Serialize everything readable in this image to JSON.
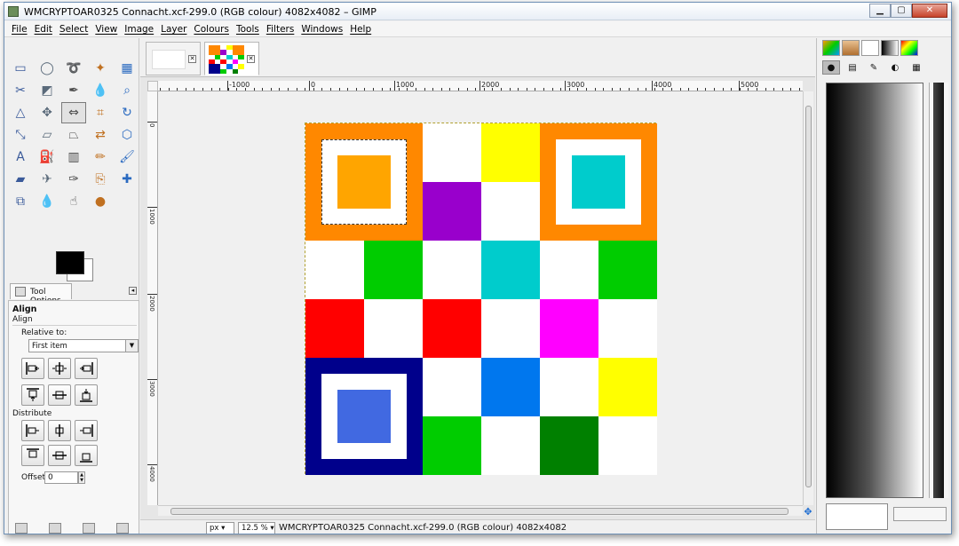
{
  "window": {
    "title": "WMCRYPTOAR0325 Connacht.xcf-299.0 (RGB colour) 4082x4082 – GIMP",
    "minimize_glyph": "▁",
    "maximize_glyph": "▢",
    "close_glyph": "✕"
  },
  "menubar": {
    "items": [
      "File",
      "Edit",
      "Select",
      "View",
      "Image",
      "Layer",
      "Colours",
      "Tools",
      "Filters",
      "Windows",
      "Help"
    ]
  },
  "toolbox": {
    "tools": [
      {
        "name": "rect-select-icon"
      },
      {
        "name": "ellipse-select-icon"
      },
      {
        "name": "free-select-icon"
      },
      {
        "name": "fuzzy-select-icon"
      },
      {
        "name": "select-by-color-icon"
      },
      {
        "name": "scissors-icon"
      },
      {
        "name": "foreground-select-icon"
      },
      {
        "name": "paths-icon"
      },
      {
        "name": "color-picker-icon"
      },
      {
        "name": "zoom-icon"
      },
      {
        "name": "measure-icon"
      },
      {
        "name": "move-icon"
      },
      {
        "name": "align-icon"
      },
      {
        "name": "crop-icon"
      },
      {
        "name": "rotate-icon"
      },
      {
        "name": "scale-icon"
      },
      {
        "name": "shear-icon"
      },
      {
        "name": "perspective-icon"
      },
      {
        "name": "flip-icon"
      },
      {
        "name": "cage-icon"
      },
      {
        "name": "text-icon"
      },
      {
        "name": "bucket-fill-icon"
      },
      {
        "name": "blend-icon"
      },
      {
        "name": "pencil-icon"
      },
      {
        "name": "paintbrush-icon"
      },
      {
        "name": "eraser-icon"
      },
      {
        "name": "airbrush-icon"
      },
      {
        "name": "ink-icon"
      },
      {
        "name": "clone-icon"
      },
      {
        "name": "heal-icon"
      },
      {
        "name": "perspective-clone-icon"
      },
      {
        "name": "blur-icon"
      },
      {
        "name": "smudge-icon"
      },
      {
        "name": "dodge-burn-icon"
      }
    ],
    "active_tool_index": 12
  },
  "tool_options": {
    "tab_label": "Tool Options",
    "title": "Align",
    "subtitle": "Align",
    "relative_label": "Relative to:",
    "relative_value": "First item",
    "distribute_label": "Distribute",
    "offset_label": "Offset:",
    "offset_value": "0"
  },
  "image_tabs": [
    {
      "name": "blank-image"
    },
    {
      "name": "qr-image",
      "active": true
    }
  ],
  "rulers": {
    "top_labels": [
      "-1000",
      "0",
      "1000",
      "2000",
      "3000",
      "4000",
      "5000"
    ],
    "left_labels": [
      "0",
      "1000",
      "2000",
      "3000",
      "4000"
    ]
  },
  "statusbar": {
    "unit": "px",
    "zoom": "12.5 %",
    "info": "WMCRYPTOAR0325 Connacht.xcf-299.0 (RGB colour) 4082x4082"
  },
  "canvas": {
    "grid": [
      [
        "F1",
        "F1",
        "w",
        "#ffff00",
        "F2",
        "F2"
      ],
      [
        "F1",
        "F1",
        "#9900cc",
        "w",
        "F2",
        "F2"
      ],
      [
        "w",
        "#00cc00",
        "w",
        "#00cccc",
        "w",
        "#00cc00"
      ],
      [
        "#ff0000",
        "w",
        "#ff0000",
        "w",
        "#ff00ff",
        "w"
      ],
      [
        "F3",
        "F3",
        "w",
        "#0077ee",
        "w",
        "#ffff00"
      ],
      [
        "F3",
        "F3",
        "#00cc00",
        "w",
        "#008000",
        "w"
      ]
    ],
    "finders": [
      {
        "id": "finder-top-left",
        "outer": "#ff8800",
        "core": "#ffa500"
      },
      {
        "id": "finder-top-right",
        "outer": "#ff8800",
        "core": "#00cccc"
      },
      {
        "id": "finder-bottom-left",
        "outer": "#00008b",
        "core": "#4169e1"
      }
    ]
  }
}
